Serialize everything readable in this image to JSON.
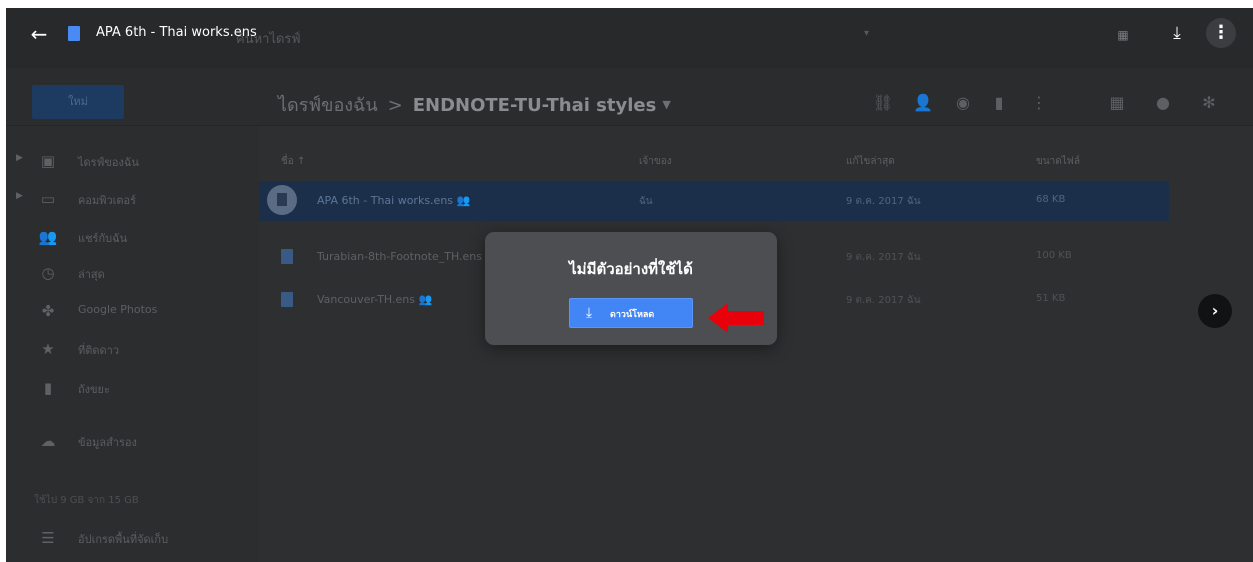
{
  "viewer": {
    "doc_title": "APA 6th - Thai works.ens",
    "back_icon": "arrow-left-icon",
    "download_icon": "download-icon",
    "more_icon": "more-vert-icon",
    "apps_icon": "apps-grid-icon"
  },
  "drive": {
    "search_placeholder": "ค้นหาไดรฟ์",
    "new_button": "ใหม่",
    "breadcrumb": {
      "root": "ไดรฟ์ของฉัน",
      "separator": ">",
      "current": "ENDNOTE-TU-Thai styles"
    },
    "sidebar": [
      {
        "label": "ไดรฟ์ของฉัน",
        "icon": "drive-icon"
      },
      {
        "label": "คอมพิวเตอร์",
        "icon": "computer-icon"
      },
      {
        "label": "แชร์กับฉัน",
        "icon": "shared-icon"
      },
      {
        "label": "ล่าสุด",
        "icon": "clock-icon"
      },
      {
        "label": "Google Photos",
        "icon": "photos-icon"
      },
      {
        "label": "ที่ติดดาว",
        "icon": "star-icon"
      },
      {
        "label": "ถังขยะ",
        "icon": "trash-icon"
      },
      {
        "label": "ข้อมูลสำรอง",
        "icon": "cloud-icon"
      },
      {
        "label": "อัปเกรดพื้นที่จัดเก็บ",
        "icon": "storage-icon"
      }
    ],
    "storage_note": "ใช้ไป 9 GB จาก 15 GB",
    "columns": {
      "name": "ชื่อ ↑",
      "owner": "เจ้าของ",
      "modified": "แก้ไขล่าสุด",
      "size": "ขนาดไฟล์"
    },
    "files": [
      {
        "name": "APA 6th - Thai works.ens",
        "shared": "👥",
        "owner": "ฉัน",
        "date": "9 ต.ค. 2017 ฉัน",
        "size": "68 KB"
      },
      {
        "name": "Turabian-8th-Footnote_TH.ens",
        "shared": "",
        "owner": "",
        "date": "9 ต.ค. 2017 ฉัน",
        "size": "100 KB"
      },
      {
        "name": "Vancouver-TH.ens",
        "shared": "👥",
        "owner": "",
        "date": "9 ต.ค. 2017 ฉัน",
        "size": "51 KB"
      }
    ]
  },
  "dialog": {
    "message": "ไม่มีตัวอย่างที่ใช้ได้",
    "button_label": "ดาวน์โหลด",
    "button_icon": "download-icon"
  },
  "colors": {
    "accent": "#4285f4",
    "annotation_arrow": "#e8000b"
  }
}
